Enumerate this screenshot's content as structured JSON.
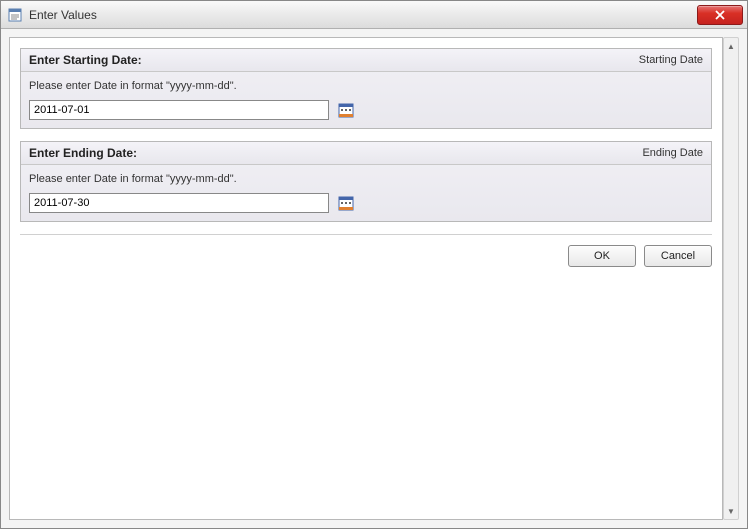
{
  "window": {
    "title": "Enter Values"
  },
  "sections": {
    "start": {
      "header_left": "Enter Starting Date:",
      "header_right": "Starting Date",
      "instruction": "Please enter Date in format \"yyyy-mm-dd\".",
      "value": "2011-07-01"
    },
    "end": {
      "header_left": "Enter Ending Date:",
      "header_right": "Ending Date",
      "instruction": "Please enter Date in format \"yyyy-mm-dd\".",
      "value": "2011-07-30"
    }
  },
  "buttons": {
    "ok": "OK",
    "cancel": "Cancel"
  }
}
